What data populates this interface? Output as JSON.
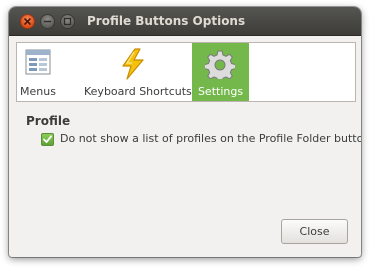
{
  "window": {
    "title": "Profile Buttons Options"
  },
  "toolbar": {
    "items": [
      {
        "label": "Menus",
        "icon": "menu-list-icon",
        "selected": false
      },
      {
        "label": "Keyboard Shortcuts",
        "icon": "lightning-icon",
        "selected": false
      },
      {
        "label": "Settings",
        "icon": "gear-icon",
        "selected": true
      }
    ]
  },
  "profile": {
    "heading": "Profile",
    "option_label": "Do not show a list of profiles on the Profile Folder button.",
    "option_checked": true
  },
  "footer": {
    "close_label": "Close"
  },
  "colors": {
    "selected_tab": "#74b84c",
    "titlebar": "#3d3c38",
    "close_button": "#df4d18"
  }
}
